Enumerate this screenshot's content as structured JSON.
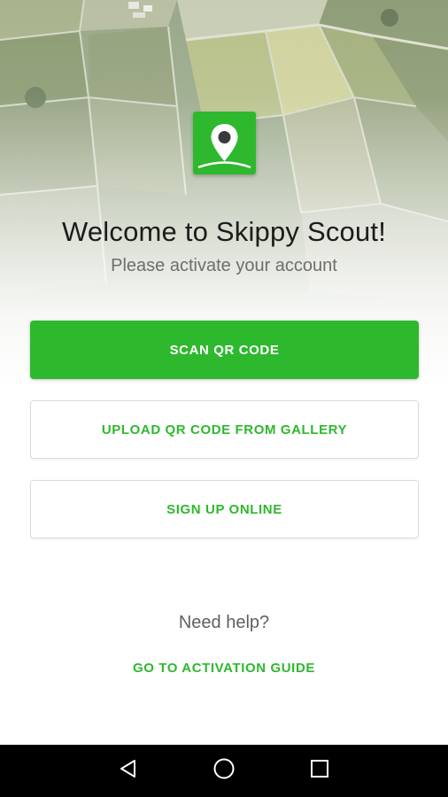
{
  "app": {
    "welcome_title": "Welcome to Skippy Scout!",
    "subtitle": "Please activate your account",
    "accent_color": "#2eb82e"
  },
  "actions": {
    "scan_qr": "SCAN QR CODE",
    "upload_qr": "UPLOAD QR CODE FROM GALLERY",
    "sign_up": "SIGN UP ONLINE"
  },
  "help": {
    "prompt": "Need help?",
    "guide_link": "GO TO ACTIVATION GUIDE"
  },
  "icons": {
    "logo": "map-pin-icon",
    "nav_back": "back-triangle-icon",
    "nav_home": "home-circle-icon",
    "nav_recent": "recent-apps-square-icon"
  }
}
